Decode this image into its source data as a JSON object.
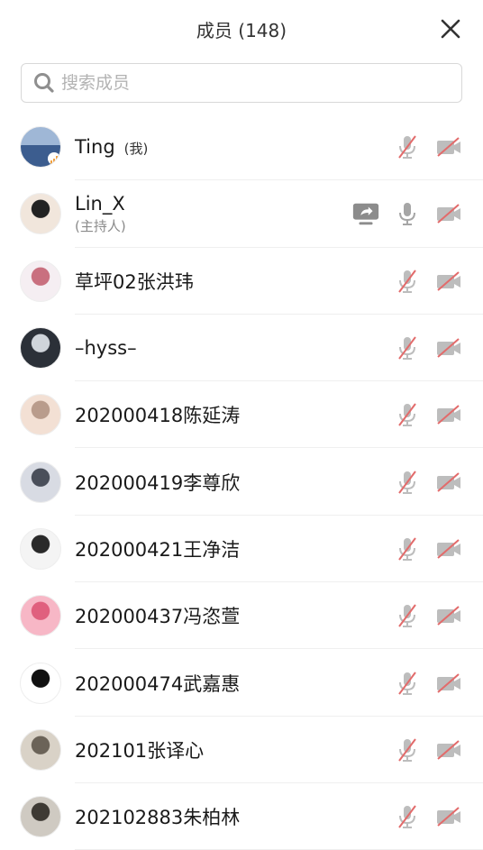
{
  "header": {
    "title": "成员 (148)"
  },
  "search": {
    "placeholder": "搜索成员"
  },
  "colors": {
    "muted_red": "#e26b6b",
    "icon_gray": "#a6a6a6",
    "share_gray": "#8c8c8c"
  },
  "members": [
    {
      "name": "Ting",
      "tag": "(我)",
      "sub": "",
      "mic": "muted",
      "camera": "off",
      "sharing": false,
      "avatar_colors": [
        "#9fb7d6",
        "#3c5d8f"
      ]
    },
    {
      "name": "Lin_X",
      "tag": "",
      "sub": "(主持人)",
      "mic": "on",
      "camera": "off",
      "sharing": true,
      "avatar_colors": [
        "#f1e6dc",
        "#222222"
      ]
    },
    {
      "name": " 草坪02张洪玮",
      "tag": "",
      "sub": "",
      "mic": "muted",
      "camera": "off",
      "sharing": false,
      "avatar_colors": [
        "#f5eef2",
        "#c9707f"
      ]
    },
    {
      "name": "–hyss–",
      "tag": "",
      "sub": "",
      "mic": "muted",
      "camera": "off",
      "sharing": false,
      "avatar_colors": [
        "#2b3038",
        "#cfd4da"
      ]
    },
    {
      "name": "202000418陈延涛",
      "tag": "",
      "sub": "",
      "mic": "muted",
      "camera": "off",
      "sharing": false,
      "avatar_colors": [
        "#f3e0d4",
        "#b99c8c"
      ]
    },
    {
      "name": "202000419李尊欣",
      "tag": "",
      "sub": "",
      "mic": "muted",
      "camera": "off",
      "sharing": false,
      "avatar_colors": [
        "#d8dbe3",
        "#4a4f5a"
      ]
    },
    {
      "name": "202000421王净洁",
      "tag": "",
      "sub": "",
      "mic": "muted",
      "camera": "off",
      "sharing": false,
      "avatar_colors": [
        "#f4f4f4",
        "#2a2a2a"
      ]
    },
    {
      "name": "202000437冯恣萱",
      "tag": "",
      "sub": "",
      "mic": "muted",
      "camera": "off",
      "sharing": false,
      "avatar_colors": [
        "#f7b7c6",
        "#e0607e"
      ]
    },
    {
      "name": "202000474武嘉惠",
      "tag": "",
      "sub": "",
      "mic": "muted",
      "camera": "off",
      "sharing": false,
      "avatar_colors": [
        "#ffffff",
        "#111111"
      ]
    },
    {
      "name": "202101张译心",
      "tag": "",
      "sub": "",
      "mic": "muted",
      "camera": "off",
      "sharing": false,
      "avatar_colors": [
        "#d9d2c7",
        "#6b6358"
      ]
    },
    {
      "name": "202102883朱柏林",
      "tag": "",
      "sub": "",
      "mic": "muted",
      "camera": "off",
      "sharing": false,
      "avatar_colors": [
        "#cfcac2",
        "#3e3a34"
      ]
    }
  ]
}
